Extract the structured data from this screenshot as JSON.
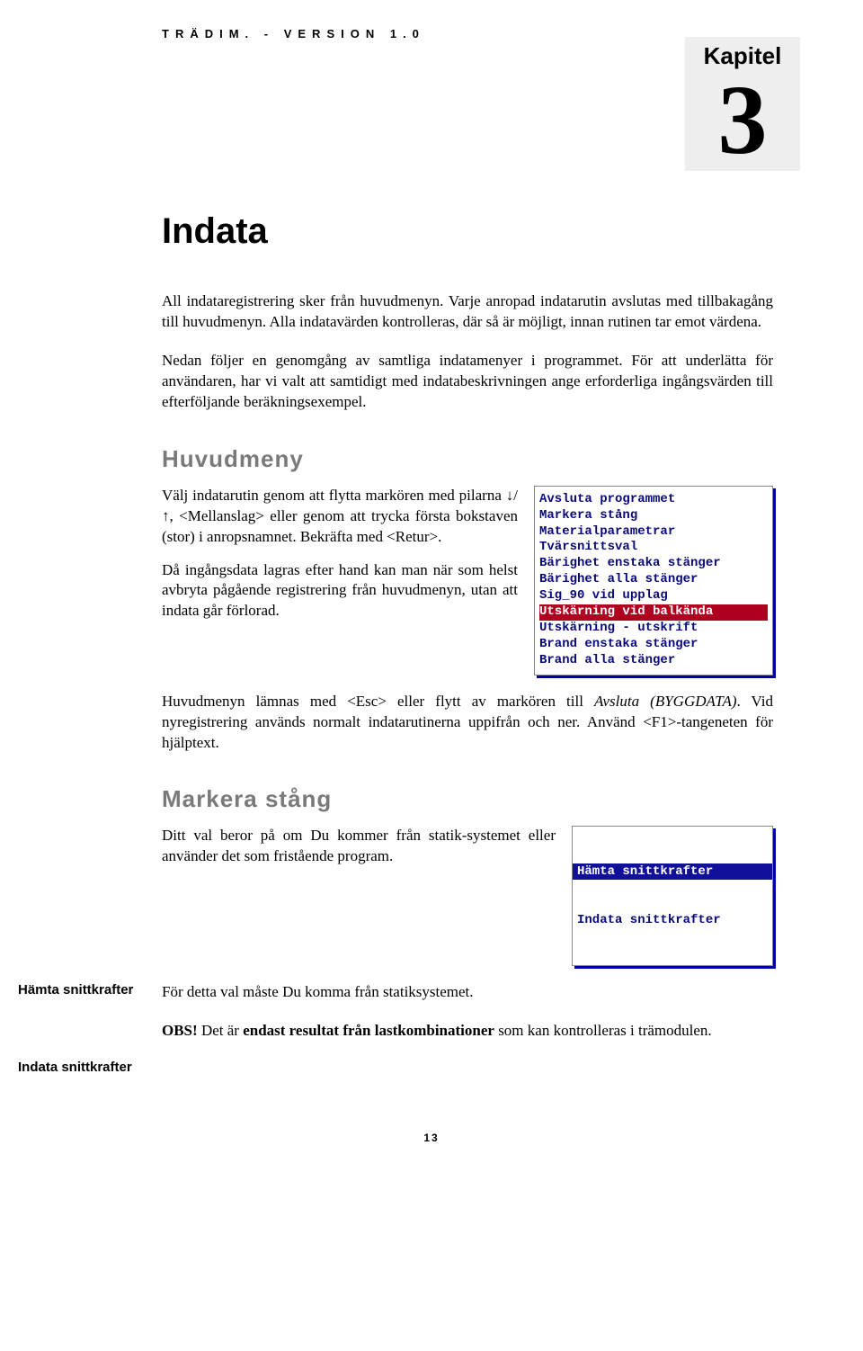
{
  "header": "TRÄDIM. - VERSION 1.0",
  "chapter": {
    "label": "Kapitel",
    "num": "3"
  },
  "title": "Indata",
  "intro1": "All indataregistrering sker från huvudmenyn. Varje anropad indatarutin avslutas med tillbakagång till huvudmenyn. Alla indatavärden kontrolleras, där så är möjligt, innan rutinen tar emot värdena.",
  "intro2": "Nedan följer en genomgång av samtliga indatamenyer i programmet. För att underlätta för användaren, har vi valt att samtidigt med indatabeskrivningen ange erforderliga ingångsvärden till efterföljande beräkningsexempel.",
  "sec1": {
    "heading": "Huvudmeny",
    "p1a": "Välj indatarutin genom att flytta markören med pilarna ",
    "p1arrows": "↓/↑",
    "p1b": ", <Mellanslag> eller genom att trycka första bokstaven (stor) i anropsnamnet. Bekräfta med <Retur>.",
    "p2": "Då ingångsdata lagras efter hand kan man när som helst avbryta pågående registrering från huvudmenyn, utan att indata går förlorad.",
    "p3a": "Huvudmenyn lämnas med <Esc> eller flytt av markören till ",
    "p3i": "Avsluta (BYGGDATA)",
    "p3b": ". Vid nyregistrering används normalt indatarutinerna uppifrån och ner. Använd <F1>-tangeneten för hjälptext.",
    "menu": [
      "Avsluta programmet",
      "Markera stång",
      "Materialparametrar",
      "Tvärsnittsval",
      "Bärighet enstaka stänger",
      "Bärighet alla stänger",
      "Sig_90 vid upplag",
      "Utskärning vid balkända",
      "Utskärning - utskrift",
      "Brand enstaka stänger",
      "Brand alla stänger"
    ],
    "selected": 7
  },
  "sec2": {
    "heading": "Markera stång",
    "p1": "Ditt val beror på om Du kommer från statik-systemet eller använder det som fristående program.",
    "menu": [
      "Hämta snittkrafter",
      "Indata snittkrafter"
    ],
    "sidenote1": "Hämta snittkrafter",
    "p2": "För detta val måste Du komma från statiksystemet.",
    "p3a": "OBS!",
    "p3b": "  Det är ",
    "p3c": "endast resultat från lastkombinationer",
    "p3d": " som kan kontrolleras i trämodulen.",
    "sidenote2": "Indata snittkrafter"
  },
  "pagenum": "13"
}
